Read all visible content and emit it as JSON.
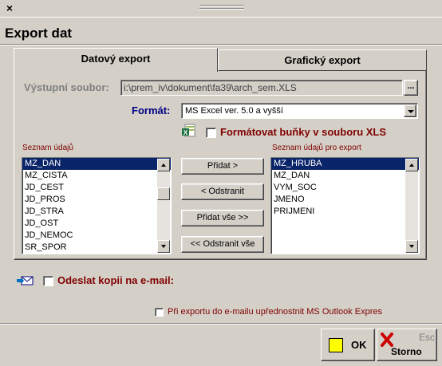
{
  "header": {
    "title": "Export dat"
  },
  "tabs": [
    {
      "label": "Datový export",
      "active": true
    },
    {
      "label": "Grafický export",
      "active": false
    }
  ],
  "output_file": {
    "label": "Výstupní soubor:",
    "value": "i:\\prem_iv\\dokument\\fa39\\arch_sem.XLS",
    "browse_label": "..."
  },
  "format": {
    "label": "Formát:",
    "selected": "MS Excel ver. 5.0 a vyšší"
  },
  "format_cells": {
    "label": "Formátovat buňky v souboru XLS",
    "checked": false
  },
  "available_list": {
    "label": "Seznam údajů",
    "items": [
      "MZ_DAN",
      "MZ_CISTA",
      "JD_CEST",
      "JD_PROS",
      "JD_STRA",
      "JD_OST",
      "JD_NEMOC",
      "SR_SPOR"
    ],
    "selected_index": 0
  },
  "export_list": {
    "label": "Seznam údajů pro export",
    "items": [
      "MZ_HRUBA",
      "MZ_DAN",
      "VYM_SOC",
      "JMENO",
      "PRIJMENI"
    ],
    "selected_index": 0
  },
  "transfer_buttons": {
    "add": "Přidat >",
    "remove": "< Odstranit",
    "add_all": "Přidat vše >>",
    "remove_all": "<< Odstranit vše"
  },
  "email": {
    "label": "Odeslat kopii na e-mail:",
    "checked": false
  },
  "outlook_pref": {
    "label": "Při exportu do e-mailu upřednostnit MS Outlook Expres",
    "checked": false
  },
  "ok_button": {
    "label": "OK"
  },
  "storno_button": {
    "label": "Storno",
    "hotkey": "Esc"
  },
  "colors": {
    "accent": "#0a246a",
    "label_red": "#800000",
    "format_blue": "#000080"
  }
}
